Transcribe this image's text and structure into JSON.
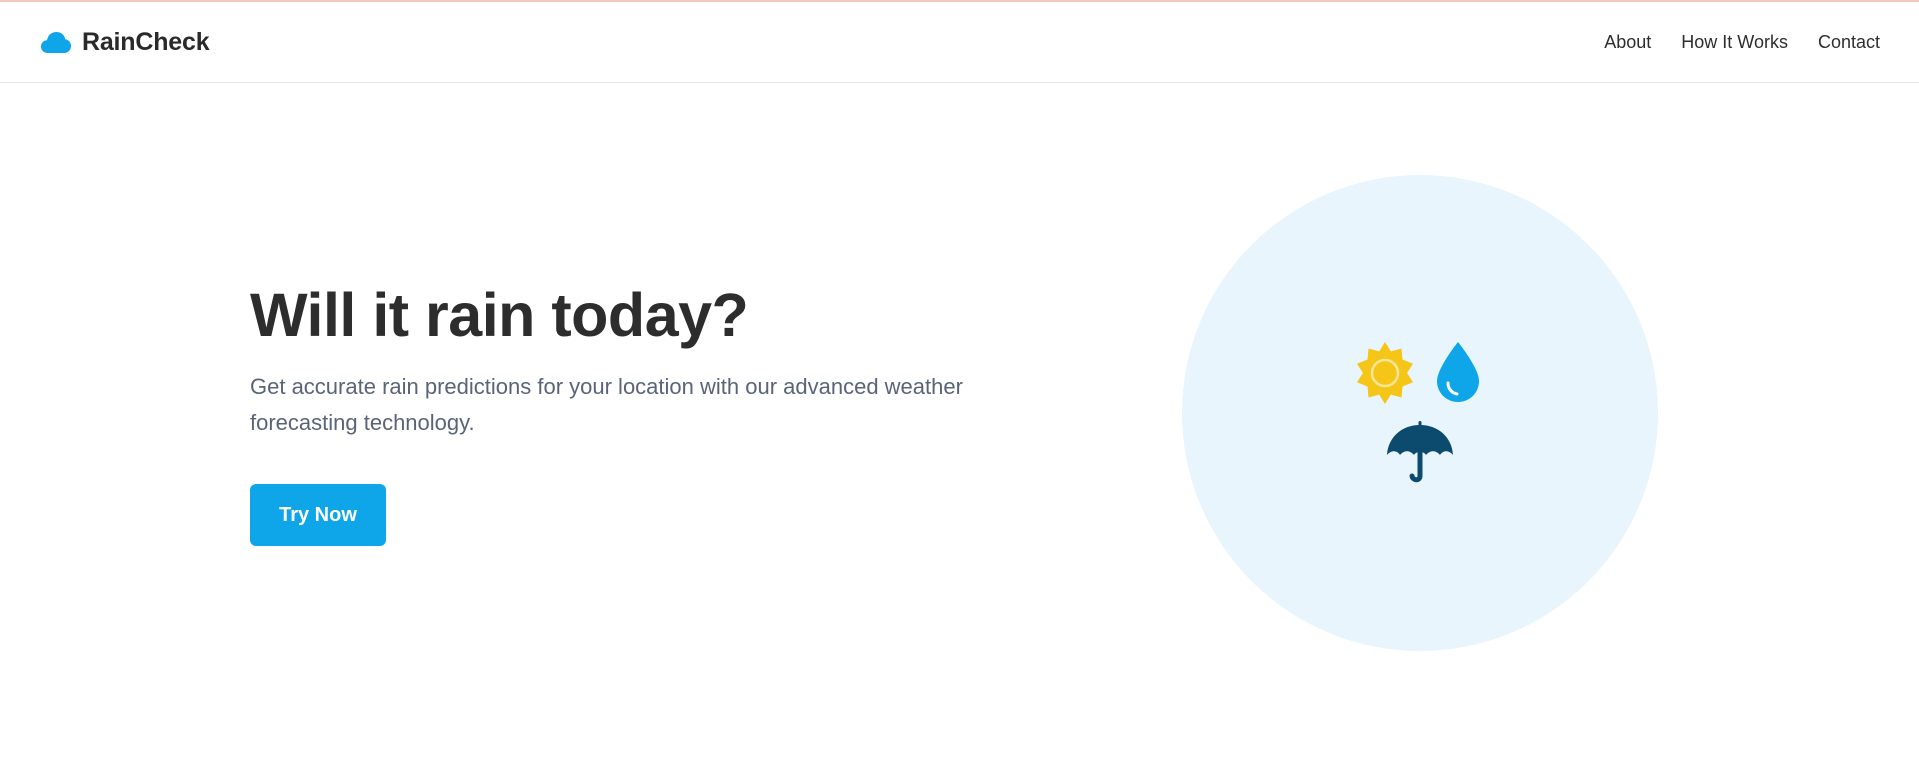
{
  "header": {
    "brand": "RainCheck",
    "nav": [
      {
        "label": "About"
      },
      {
        "label": "How It Works"
      },
      {
        "label": "Contact"
      }
    ]
  },
  "hero": {
    "title": "Will it rain today?",
    "subtitle": "Get accurate rain predictions for your location with our advanced weather forecasting technology.",
    "cta_label": "Try Now"
  },
  "icons": {
    "logo": "cloud-icon",
    "illustration": [
      "sun-icon",
      "water-drop-icon",
      "umbrella-icon"
    ]
  },
  "colors": {
    "accent": "#0ea5e9",
    "sun": "#f5c518",
    "umbrella": "#0c4a6e",
    "circle": "#e8f5fd",
    "text": "#2d2d2d",
    "subtext": "#5a6478"
  }
}
